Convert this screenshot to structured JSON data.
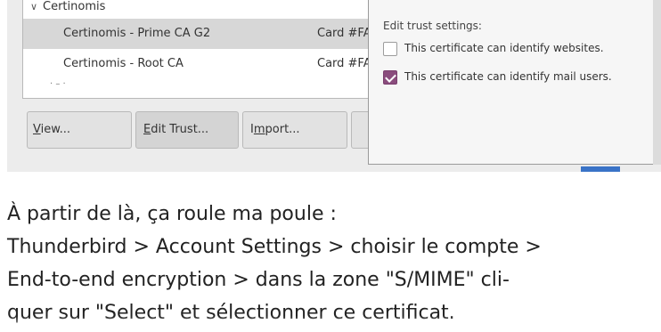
{
  "cert_manager": {
    "group": {
      "name": "Certinomis"
    },
    "certs": [
      {
        "name": "Certinomis - Prime CA G2",
        "device": "Card #FA"
      },
      {
        "name": "Certinomis - Root CA",
        "device": "Card #FA"
      }
    ],
    "buttons": {
      "view": {
        "label_u": "V",
        "label_rest": "iew..."
      },
      "edit_trust": {
        "label_u": "E",
        "label_rest": "dit Trust..."
      },
      "import": {
        "label_a": "I",
        "label_u": "m",
        "label_rest": "port..."
      }
    }
  },
  "trust_dialog": {
    "title": "Edit trust settings:",
    "options": [
      {
        "label": "This certificate can identify websites.",
        "checked": false
      },
      {
        "label": "This certificate can identify mail users.",
        "checked": true
      }
    ]
  },
  "article": {
    "lines": [
      "À partir de là, ça roule ma poule :",
      "Thunderbird > Account Settings > choisir le compte >",
      "End-to-end encryption > dans la zone \"S/MIME\" cli-",
      "quer sur \"Select\" et sélectionner ce certificat."
    ]
  },
  "colors": {
    "checkbox_checked": "#8a4c7d",
    "selected_row": "#d7d7d7",
    "accent_strip": "#3a73c7"
  }
}
